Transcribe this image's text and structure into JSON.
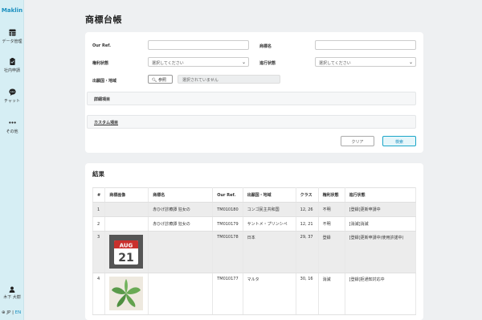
{
  "app": {
    "brand": "Maklin",
    "page_title": "商標台帳"
  },
  "sidebar": {
    "items": [
      {
        "label": "データ管理",
        "icon": "table-icon"
      },
      {
        "label": "社内申請",
        "icon": "clipboard-icon"
      },
      {
        "label": "チャット",
        "icon": "chat-icon"
      },
      {
        "label": "その他",
        "icon": "more-icon"
      }
    ],
    "user": {
      "name": "木下 大樹",
      "icon": "user-icon"
    },
    "lang": {
      "icon": "globe-icon",
      "jp": "JP",
      "sep": "|",
      "en": "EN",
      "active": "EN"
    }
  },
  "search": {
    "our_ref_label": "Our Ref.",
    "our_ref_value": "",
    "mark_name_label": "商標名",
    "mark_name_value": "",
    "rights_status_label": "権利状態",
    "rights_status_value": "選択してください",
    "progress_status_label": "進行状態",
    "progress_status_value": "選択してください",
    "country_label": "出願国・地域",
    "ref_button": "参照",
    "country_placeholder": "選択されていません",
    "detail_section": "詳細項目",
    "custom_section": "カスタム項目",
    "clear_button": "クリア",
    "search_button": "検索"
  },
  "results": {
    "title": "結果",
    "columns": [
      "#",
      "商標画像",
      "商標名",
      "Our Ref.",
      "出願国・地域",
      "クラス",
      "権利状態",
      "進行状態"
    ],
    "rows": [
      {
        "num": "1",
        "image": "",
        "name": "赤ひげ診療譚 狂女の",
        "ref": "TM010180",
        "country": "コンゴ民主共和国",
        "classes": "12, 26",
        "rights": "不明",
        "progress": "[登録]更新申請中"
      },
      {
        "num": "2",
        "image": "",
        "name": "赤ひげ診療譚 狂女の",
        "ref": "TM010179",
        "country": "サントメ・プリンシペ",
        "classes": "12, 21",
        "rights": "不明",
        "progress": "[消滅]消滅"
      },
      {
        "num": "3",
        "image": "calendar-icon",
        "image_month": "AUG",
        "image_day": "21",
        "name": "",
        "ref": "TM010178",
        "country": "日本",
        "classes": "29, 37",
        "rights": "登録",
        "progress": "[登録]更新申請中(使用許諾中)"
      },
      {
        "num": "4",
        "image": "leaves-icon",
        "name": "",
        "ref": "TM010177",
        "country": "マルタ",
        "classes": "30, 16",
        "rights": "消滅",
        "progress": "[登録]拒通知対応中"
      }
    ]
  },
  "colors": {
    "accent": "#1a8fbf",
    "sidebar_bg": "#d6eef4",
    "page_bg": "#eef0f2"
  }
}
